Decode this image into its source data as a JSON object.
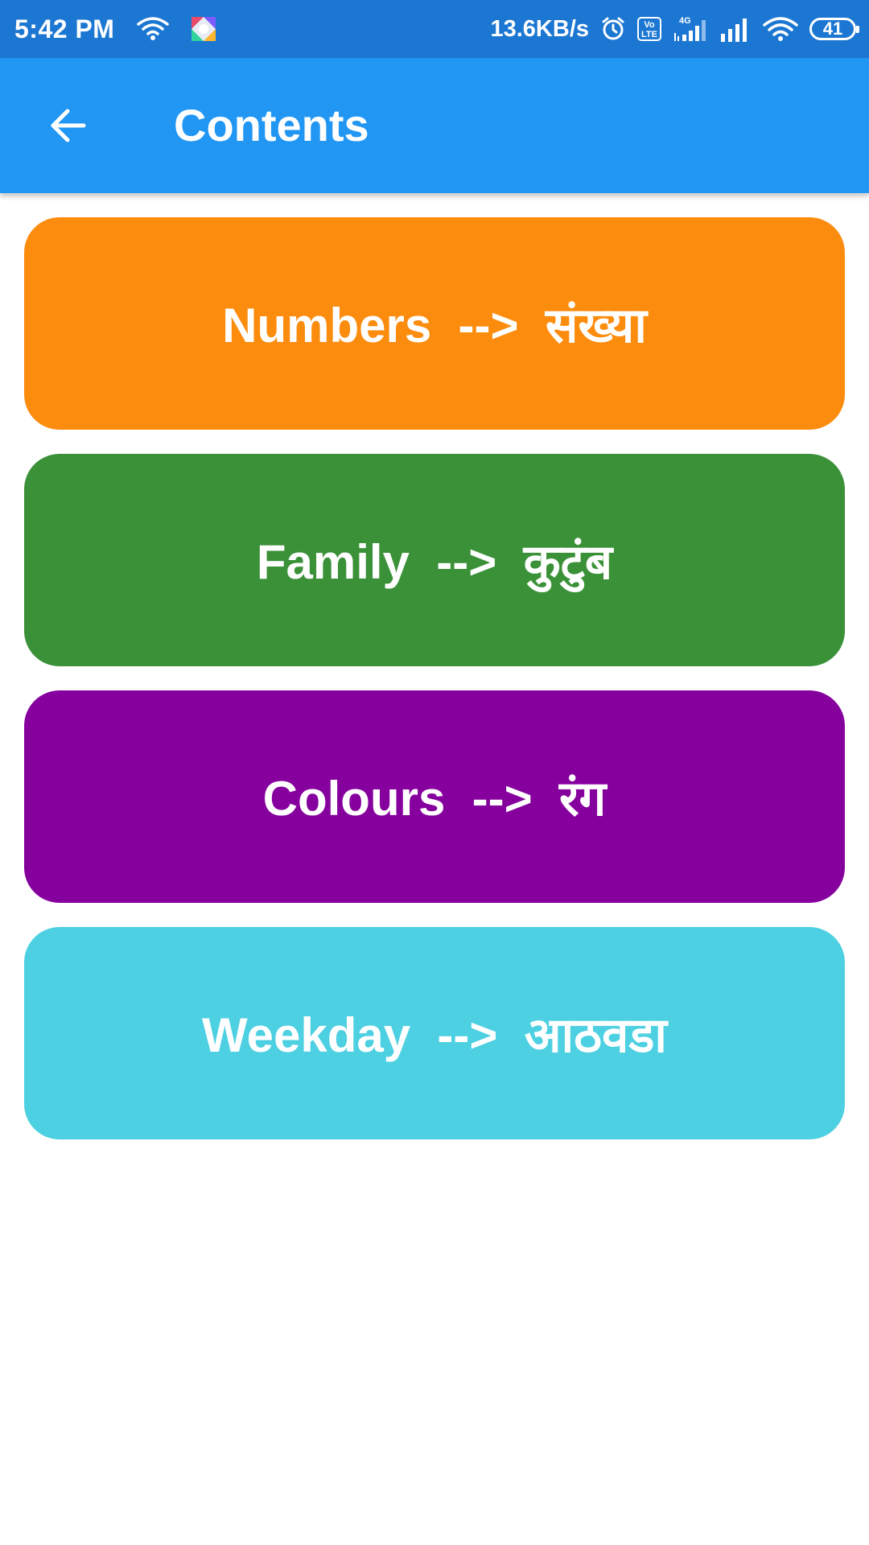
{
  "status_bar": {
    "time": "5:42 PM",
    "net_speed": "13.6KB/s",
    "volte_label": "Vo\nLTE",
    "battery_level": "41",
    "icons": [
      "wifi-icon",
      "app-notification-icon",
      "alarm-icon",
      "volte-icon",
      "signal-4g-icon",
      "signal-icon",
      "wifi-icon",
      "battery-icon"
    ]
  },
  "app_bar": {
    "title": "Contents",
    "back_icon": "arrow-left-icon"
  },
  "cards": [
    {
      "label": "Numbers  -->  संख्या",
      "color": "#fc8c0e"
    },
    {
      "label": "Family  -->  कुटुंब",
      "color": "#3a9138"
    },
    {
      "label": "Colours  -->  रंग",
      "color": "#86009e"
    },
    {
      "label": "Weekday  -->  आठवडा",
      "color": "#4dd0e2"
    }
  ],
  "colors": {
    "status_bar": "#1c77d2",
    "app_bar": "#2196f3",
    "background": "#ffffff"
  }
}
